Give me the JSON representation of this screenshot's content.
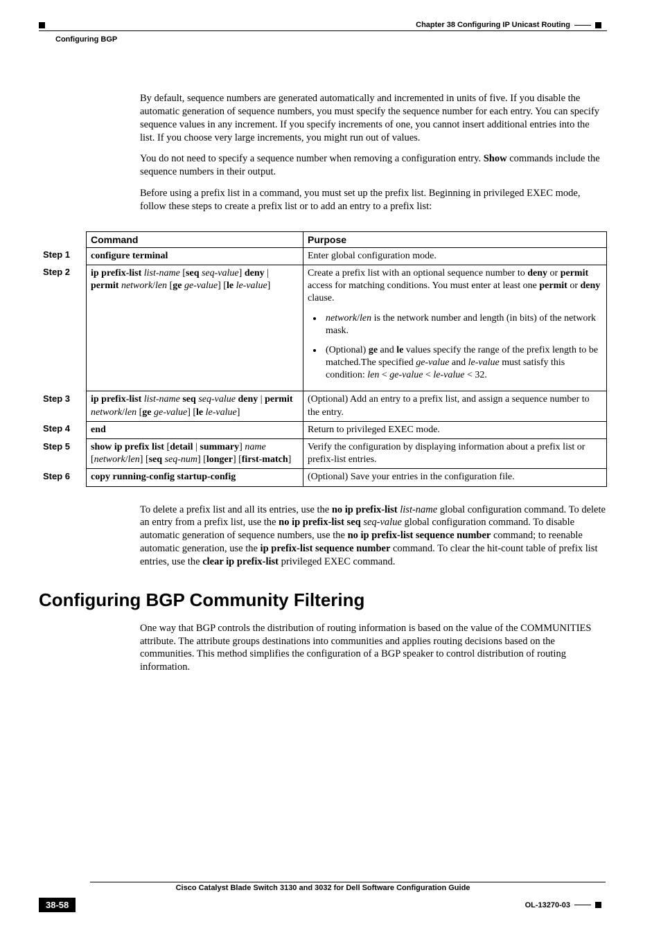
{
  "header": {
    "chapter": "Chapter 38    Configuring IP Unicast Routing",
    "section": "Configuring BGP"
  },
  "para1": "By default, sequence numbers are generated automatically and incremented in units of five. If you disable the automatic generation of sequence numbers, you must specify the sequence number for each entry. You can specify sequence values in any increment. If you specify increments of one, you cannot insert additional entries into the list. If you choose very large increments, you might run out of values.",
  "para2_a": "You do not need to specify a sequence number when removing a configuration entry. ",
  "para2_b": "Show",
  "para2_c": " commands include the sequence numbers in their output.",
  "para3": "Before using a prefix list in a command, you must set up the prefix list. Beginning in privileged EXEC mode, follow these steps to create a prefix list or to add an entry to a prefix list:",
  "table": {
    "h_step": "",
    "h_cmd": "Command",
    "h_purpose": "Purpose",
    "rows": [
      {
        "step": "Step 1",
        "cmd": [
          {
            "t": "configure terminal",
            "b": true
          }
        ],
        "purpose_main": [
          {
            "t": "Enter global configuration mode."
          }
        ],
        "bullets": []
      },
      {
        "step": "Step 2",
        "cmd": [
          {
            "t": "ip prefix-list ",
            "b": true
          },
          {
            "t": "list-name",
            "i": true
          },
          {
            "t": " ["
          },
          {
            "t": "seq",
            "b": true
          },
          {
            "t": " "
          },
          {
            "t": "seq-value",
            "i": true
          },
          {
            "t": "] "
          },
          {
            "t": "deny",
            "b": true
          },
          {
            "t": " | "
          },
          {
            "t": "permit",
            "b": true
          },
          {
            "t": " "
          },
          {
            "t": "network",
            "i": true
          },
          {
            "t": "/"
          },
          {
            "t": "len",
            "i": true
          },
          {
            "t": " ["
          },
          {
            "t": "ge",
            "b": true
          },
          {
            "t": " "
          },
          {
            "t": "ge-value",
            "i": true
          },
          {
            "t": "] ["
          },
          {
            "t": "le",
            "b": true
          },
          {
            "t": " "
          },
          {
            "t": "le-value",
            "i": true
          },
          {
            "t": "]"
          }
        ],
        "purpose_main": [
          {
            "t": "Create a prefix list with an optional sequence number to "
          },
          {
            "t": "deny",
            "b": true
          },
          {
            "t": " or "
          },
          {
            "t": "permit",
            "b": true
          },
          {
            "t": " access for matching conditions. You must enter at least one "
          },
          {
            "t": "permit",
            "b": true
          },
          {
            "t": " or "
          },
          {
            "t": "deny",
            "b": true
          },
          {
            "t": " clause."
          }
        ],
        "bullets": [
          [
            {
              "t": "network",
              "i": true
            },
            {
              "t": "/"
            },
            {
              "t": "len",
              "i": true
            },
            {
              "t": " is the network number and length (in bits) of the network mask."
            }
          ],
          [
            {
              "t": "(Optional) "
            },
            {
              "t": "ge",
              "b": true
            },
            {
              "t": " and "
            },
            {
              "t": "le",
              "b": true
            },
            {
              "t": " values specify the range of the prefix length to be matched.The specified "
            },
            {
              "t": "ge-value",
              "i": true
            },
            {
              "t": " and "
            },
            {
              "t": "le-value",
              "i": true
            },
            {
              "t": " must satisfy this condition: "
            },
            {
              "t": "len",
              "i": true
            },
            {
              "t": " < "
            },
            {
              "t": "ge-value",
              "i": true
            },
            {
              "t": " < "
            },
            {
              "t": "le-value",
              "i": true
            },
            {
              "t": " < 32."
            }
          ]
        ]
      },
      {
        "step": "Step 3",
        "cmd": [
          {
            "t": "ip prefix-list ",
            "b": true
          },
          {
            "t": "list-name",
            "i": true
          },
          {
            "t": " "
          },
          {
            "t": "seq",
            "b": true
          },
          {
            "t": " "
          },
          {
            "t": "seq-value",
            "i": true
          },
          {
            "t": " "
          },
          {
            "t": "deny",
            "b": true
          },
          {
            "t": " | "
          },
          {
            "t": "permit",
            "b": true
          },
          {
            "t": " "
          },
          {
            "t": "network",
            "i": true
          },
          {
            "t": "/"
          },
          {
            "t": "len",
            "i": true
          },
          {
            "t": " ["
          },
          {
            "t": "ge",
            "b": true
          },
          {
            "t": " "
          },
          {
            "t": "ge-value",
            "i": true
          },
          {
            "t": "] ["
          },
          {
            "t": "le",
            "b": true
          },
          {
            "t": " "
          },
          {
            "t": "le-value",
            "i": true
          },
          {
            "t": "]"
          }
        ],
        "purpose_main": [
          {
            "t": "(Optional) Add an entry to a prefix list, and assign a sequence number to the entry."
          }
        ],
        "bullets": []
      },
      {
        "step": "Step 4",
        "cmd": [
          {
            "t": "end",
            "b": true
          }
        ],
        "purpose_main": [
          {
            "t": "Return to privileged EXEC mode."
          }
        ],
        "bullets": []
      },
      {
        "step": "Step 5",
        "cmd": [
          {
            "t": "show ip prefix list",
            "b": true
          },
          {
            "t": " ["
          },
          {
            "t": "detail",
            "b": true
          },
          {
            "t": " | "
          },
          {
            "t": "summary",
            "b": true
          },
          {
            "t": "] "
          },
          {
            "t": "name",
            "i": true
          },
          {
            "t": " ["
          },
          {
            "t": "network",
            "i": true
          },
          {
            "t": "/"
          },
          {
            "t": "len",
            "i": true
          },
          {
            "t": "] ["
          },
          {
            "t": "seq",
            "b": true
          },
          {
            "t": " "
          },
          {
            "t": "seq-num",
            "i": true
          },
          {
            "t": "] ["
          },
          {
            "t": "longer",
            "b": true
          },
          {
            "t": "] ["
          },
          {
            "t": "first-match",
            "b": true
          },
          {
            "t": "]"
          }
        ],
        "purpose_main": [
          {
            "t": "Verify the configuration by displaying information about a prefix list or prefix-list entries."
          }
        ],
        "bullets": []
      },
      {
        "step": "Step 6",
        "cmd": [
          {
            "t": "copy running-config startup-config",
            "b": true
          }
        ],
        "purpose_main": [
          {
            "t": "(Optional) Save your entries in the configuration file."
          }
        ],
        "bullets": []
      }
    ]
  },
  "para4": [
    {
      "t": "To delete a prefix list and all its entries, use the "
    },
    {
      "t": "no ip prefix-list",
      "b": true
    },
    {
      "t": " "
    },
    {
      "t": "list-name",
      "i": true
    },
    {
      "t": " global configuration command. To delete an entry from a prefix list, use the "
    },
    {
      "t": "no ip prefix-list seq",
      "b": true
    },
    {
      "t": " "
    },
    {
      "t": "seq-value",
      "i": true
    },
    {
      "t": " global configuration command. To disable automatic generation of sequence numbers, use the "
    },
    {
      "t": "no ip prefix-list sequence number",
      "b": true
    },
    {
      "t": " command; to reenable automatic generation, use the "
    },
    {
      "t": "ip prefix-list sequence number",
      "b": true
    },
    {
      "t": " command. To clear the hit-count table of prefix list entries, use the "
    },
    {
      "t": "clear ip prefix-list",
      "b": true
    },
    {
      "t": " privileged EXEC command."
    }
  ],
  "section_heading": "Configuring BGP Community Filtering",
  "para5": "One way that BGP controls the distribution of routing information is based on the value of the COMMUNITIES attribute. The attribute groups destinations into communities and applies routing decisions based on the communities. This method simplifies the configuration of a BGP speaker to control distribution of routing information.",
  "footer": {
    "title": "Cisco Catalyst Blade Switch 3130 and 3032 for Dell Software Configuration Guide",
    "page": "38-58",
    "docid": "OL-13270-03"
  }
}
